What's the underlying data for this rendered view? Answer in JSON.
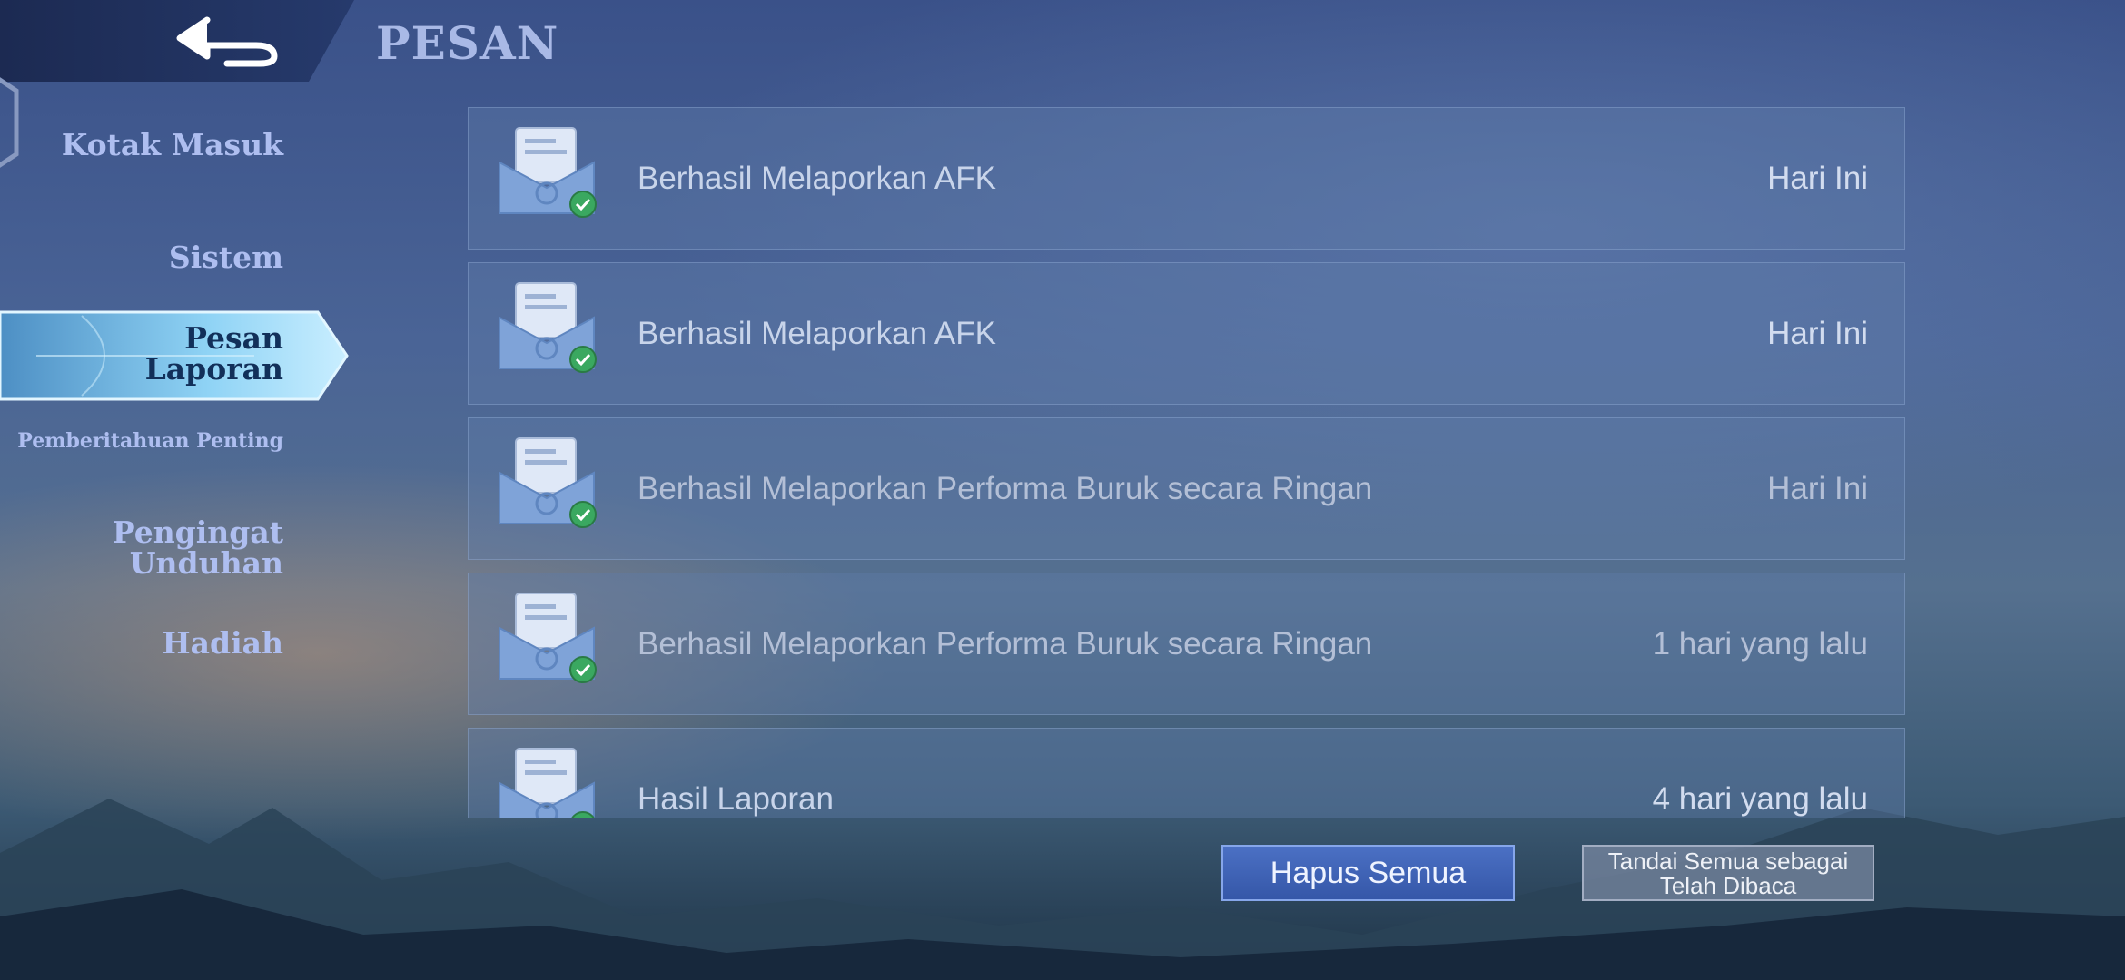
{
  "header": {
    "title": "PESAN",
    "back_icon": "back-arrow-icon"
  },
  "sidebar": {
    "items": [
      {
        "label": "Kotak Masuk",
        "active": false
      },
      {
        "label": "Sistem",
        "active": false
      },
      {
        "label": "Pesan Laporan",
        "active": true
      },
      {
        "label": "Pemberitahuan Penting",
        "active": false
      },
      {
        "label": "Pengingat Unduhan",
        "active": false
      },
      {
        "label": "Hadiah",
        "active": false
      }
    ]
  },
  "messages": [
    {
      "subject": "Berhasil Melaporkan AFK",
      "time": "Hari Ini",
      "icon": "envelope-check-icon"
    },
    {
      "subject": "Berhasil Melaporkan AFK",
      "time": "Hari Ini",
      "icon": "envelope-check-icon"
    },
    {
      "subject": "Berhasil Melaporkan Performa Buruk secara Ringan",
      "time": "Hari Ini",
      "icon": "envelope-check-icon"
    },
    {
      "subject": "Berhasil Melaporkan Performa Buruk secara Ringan",
      "time": "1 hari yang lalu",
      "icon": "envelope-check-icon"
    },
    {
      "subject": "Hasil Laporan",
      "time": "4 hari yang lalu",
      "icon": "envelope-check-icon"
    }
  ],
  "actions": {
    "clear_all": "Hapus Semua",
    "mark_all_read": "Tandai Semua sebagai Telah Dibaca"
  },
  "colors": {
    "accent": "#3557a8",
    "active_tab": "#7fc7ee",
    "check": "#3aa860"
  }
}
